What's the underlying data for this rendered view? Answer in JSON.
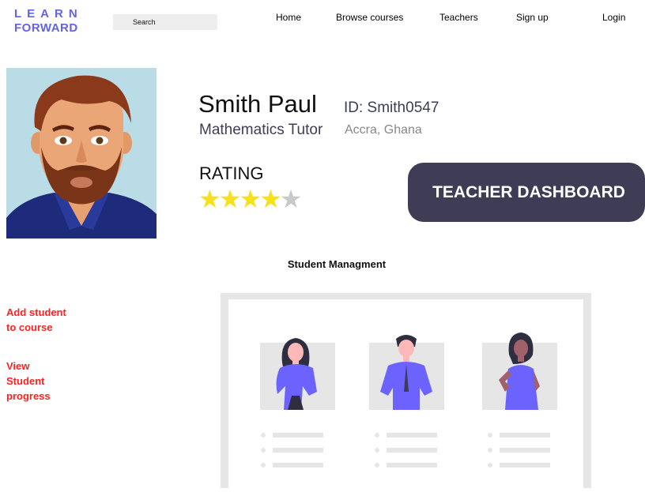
{
  "logo": {
    "line1": "LEARN",
    "line2": "FORWARD"
  },
  "search": {
    "placeholder": "Search"
  },
  "nav": {
    "items": [
      "Home",
      "Browse courses",
      "Teachers",
      "Sign up",
      "Login"
    ]
  },
  "profile": {
    "name": "Smith Paul",
    "id": "ID: Smith0547",
    "role": "Mathematics Tutor",
    "location": "Accra, Ghana",
    "rating_label": "RATING",
    "rating": {
      "value": 4,
      "max": 5
    }
  },
  "dashboard_button": {
    "label": "TEACHER DASHBOARD"
  },
  "section": {
    "title": "Student Managment"
  },
  "sidebar": {
    "add_student": [
      "Add student",
      "to course"
    ],
    "view_progress": [
      "View",
      "Student",
      "progress"
    ]
  },
  "colors": {
    "brand": "#6264e0",
    "dashboard_bg": "#3f3d56",
    "link_red": "#ff2121",
    "star": "#f7e21a",
    "accent_purple": "#6c63ff"
  }
}
